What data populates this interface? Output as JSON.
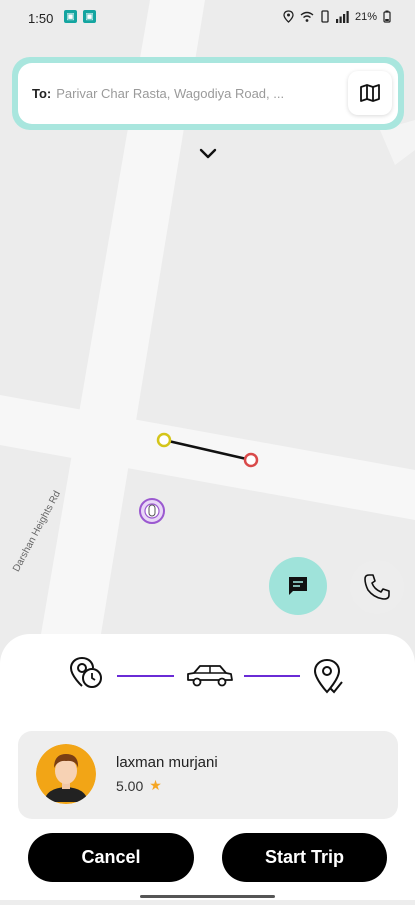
{
  "status_bar": {
    "time": "1:50",
    "battery": "21%",
    "left_icons": [
      "notification-app-icon",
      "notification-app-icon"
    ],
    "right_icons": [
      "location-icon",
      "wifi-icon",
      "vibrate-icon",
      "signal-icon",
      "battery-icon"
    ]
  },
  "search": {
    "to_label": "To:",
    "destination": "Parivar Char Rasta, Wagodiya Road, ...",
    "map_icon": "map-icon"
  },
  "map": {
    "road_label": "Darshan Heights Rd",
    "route_start_color": "#d4c51a",
    "route_end_color": "#d94a4a",
    "vehicle_marker_color": "#8e44ad"
  },
  "actions": {
    "chat_icon": "chat-icon",
    "call_icon": "phone-icon",
    "accent": "#9fe3da"
  },
  "trip_progress": {
    "steps": [
      "pickup-clock-icon",
      "car-icon",
      "destination-pin-icon"
    ],
    "line_color": "#6a2bd6"
  },
  "driver": {
    "name": "laxman murjani",
    "rating": "5.00"
  },
  "buttons": {
    "cancel": "Cancel",
    "start_trip": "Start Trip"
  }
}
